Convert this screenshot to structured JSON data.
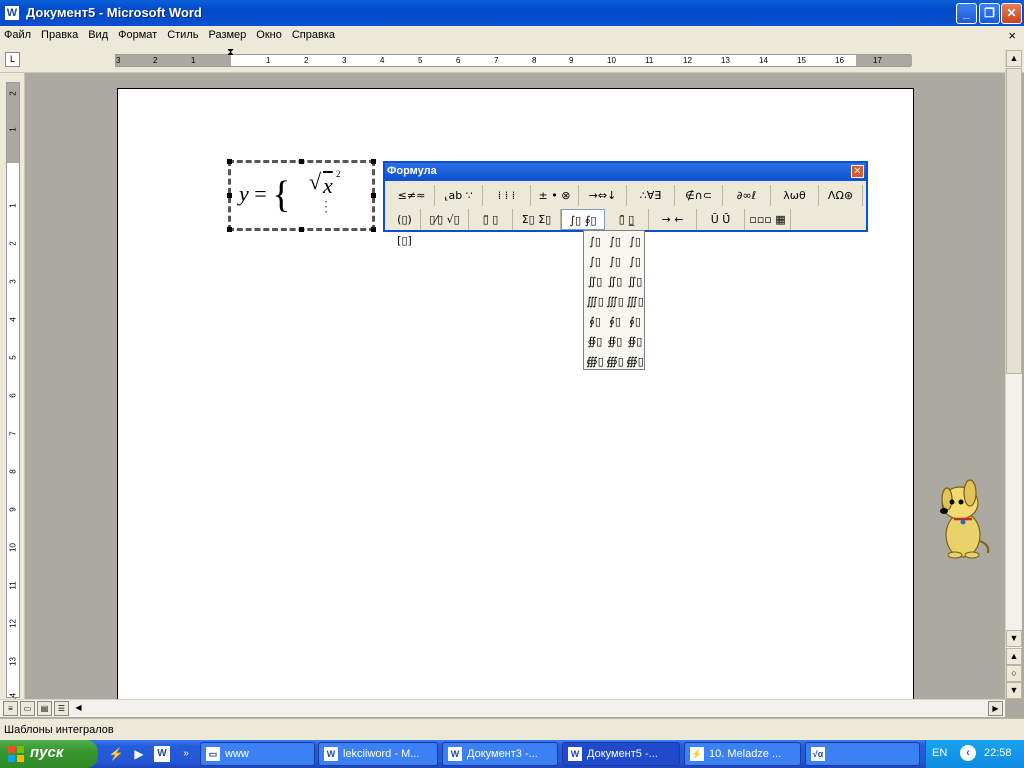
{
  "window": {
    "title": "Документ5 - Microsoft Word",
    "app_icon": "word-icon"
  },
  "menubar": {
    "items": [
      "Файл",
      "Правка",
      "Вид",
      "Формат",
      "Стиль",
      "Размер",
      "Окно",
      "Справка"
    ],
    "close": "×"
  },
  "ruler": {
    "h_ticks": [
      "3",
      "2",
      "1",
      "1",
      "2",
      "3",
      "4",
      "5",
      "6",
      "7",
      "8",
      "9",
      "10",
      "11",
      "12",
      "13",
      "14",
      "15",
      "16",
      "17"
    ],
    "v_ticks": [
      "2",
      "1",
      "1",
      "2",
      "3",
      "4",
      "5",
      "6",
      "7",
      "8",
      "9",
      "10",
      "11",
      "12",
      "13",
      "14"
    ]
  },
  "formula": {
    "lhs": "y",
    "eq": "=",
    "brace": "{",
    "radical": "√",
    "var": "x",
    "exp": "2",
    "placeholder": "⋮"
  },
  "palette": {
    "title": "Формула",
    "row1": [
      "≤≠≈",
      "⸤ab ∵",
      "⁞ ⁞ ⁞",
      "± • ⊗",
      "→⇔↓",
      "∴∀∃",
      "∉∩⊂",
      "∂∞ℓ",
      "λωθ",
      "ΛΩ⊛"
    ],
    "row2": [
      "(▯) [▯]",
      "▯⁄▯ √▯",
      "▯̈ ▯",
      "Σ▯ Σ▯",
      "∫▯ ∮▯",
      "▯̄ ▯̲",
      "→ ←",
      "Ū Ū̇",
      "▫▫▫ ▦"
    ]
  },
  "dropdown": {
    "items": [
      "∫▯",
      "∫▯",
      "∫▯",
      "∫▯",
      "∫▯",
      "∫▯",
      "∬▯",
      "∬▯",
      "∬▯",
      "∭▯",
      "∭▯",
      "∭▯",
      "∮▯",
      "∮▯",
      "∮▯",
      "∯▯",
      "∯▯",
      "∯▯",
      "∰▯",
      "∰▯",
      "∰▯"
    ]
  },
  "statusbar": {
    "text": "Шаблоны интегралов"
  },
  "taskbar": {
    "start": "пуск",
    "tasks": [
      {
        "label": "www",
        "icon": "folder-icon"
      },
      {
        "label": "lekciiword - M...",
        "icon": "word-icon"
      },
      {
        "label": "Документ3 -...",
        "icon": "word-icon"
      },
      {
        "label": "Документ5 -...",
        "icon": "word-icon"
      },
      {
        "label": "10. Meladze ...",
        "icon": "winamp-icon"
      },
      {
        "label": "",
        "icon": "equation-icon"
      }
    ],
    "lang": "EN",
    "clock": "22:58"
  }
}
